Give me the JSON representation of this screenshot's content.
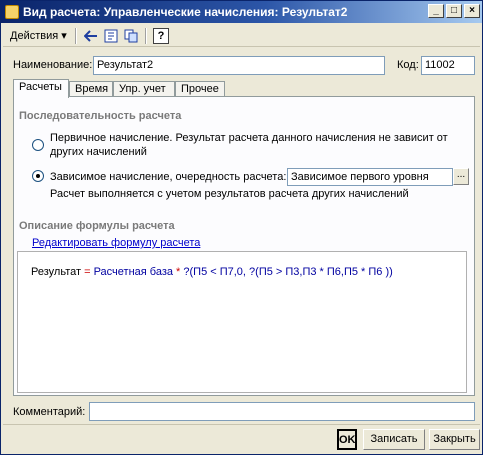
{
  "window": {
    "title": "Вид расчета: Управленческие начисления: Результат2",
    "minimize_glyph": "_",
    "maximize_glyph": "□",
    "close_glyph": "×"
  },
  "toolbar": {
    "actions_label": "Действия",
    "help_glyph": "?"
  },
  "form": {
    "name_label": "Наименование:",
    "name_value": "Результат2",
    "code_label": "Код:",
    "code_value": "11002"
  },
  "tabs": [
    {
      "label": "Расчеты",
      "active": true
    },
    {
      "label": "Время",
      "active": false
    },
    {
      "label": "Упр. учет",
      "active": false
    },
    {
      "label": "Прочее",
      "active": false
    }
  ],
  "calc_order": {
    "section_title": "Последовательность расчета",
    "option1_label": "Первичное начисление. Результат расчета данного начисления не зависит от",
    "option1_label_line2": "других начислений",
    "option2_label": "Зависимое начисление, очередность расчета:",
    "option2_value": "Зависимое первого уровня",
    "option2_select_glyph": "...",
    "option2_hint": "Расчет выполняется с учетом результатов расчета других начислений",
    "selected_option": 2
  },
  "formula": {
    "section_title": "Описание формулы расчета",
    "edit_link": "Редактировать формулу расчета",
    "parts": [
      {
        "text": "Результат",
        "kind": "v"
      },
      {
        "text": " = ",
        "kind": "op"
      },
      {
        "text": "Расчетная база",
        "kind": "k"
      },
      {
        "text": " * ",
        "kind": "op"
      },
      {
        "text": "?(П5 < П7,0, ?(П5 > П3,П3 * П6,П5 * П6 ))",
        "kind": "k"
      }
    ]
  },
  "comment": {
    "label": "Комментарий:",
    "value": ""
  },
  "buttons": {
    "ok": "OK",
    "save": "Записать",
    "close": "Закрыть"
  }
}
